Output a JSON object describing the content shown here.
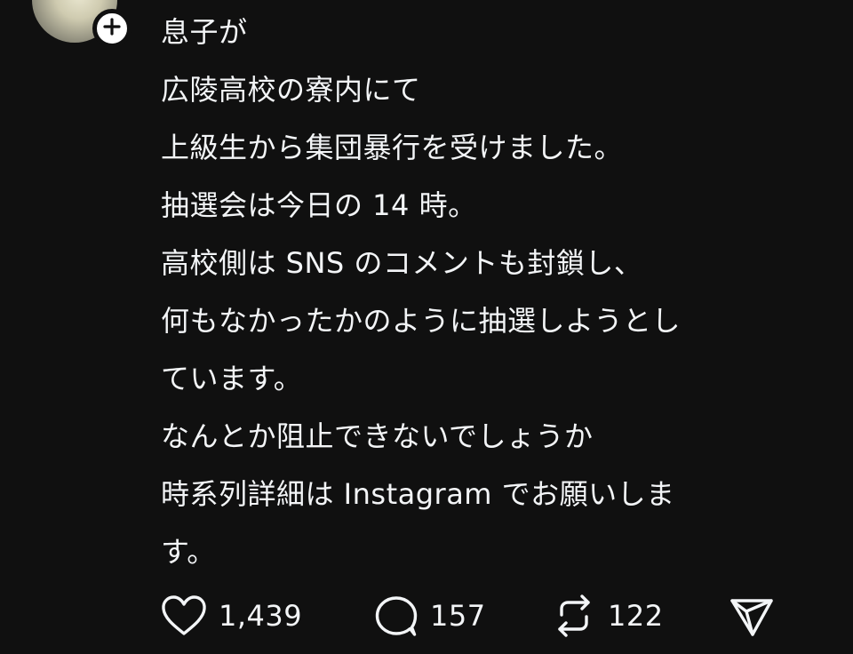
{
  "post": {
    "lines": [
      "息子が",
      "広陵高校の寮内にて",
      "上級生から集団暴行を受けました。",
      "抽選会は今日の 14 時。",
      "高校側は SNS のコメントも封鎖し、",
      "何もなかったかのように抽選しようとし",
      "ています。",
      "なんとか阻止できないでしょうか",
      "時系列詳細は Instagram でお願いしま",
      "す。"
    ]
  },
  "actions": {
    "like_count": "1,439",
    "reply_count": "157",
    "repost_count": "122",
    "like_icon": "heart-icon",
    "reply_icon": "speech-bubble-icon",
    "repost_icon": "repost-arrows-icon",
    "share_icon": "paper-plane-icon"
  },
  "avatar": {
    "badge_icon": "plus-icon"
  },
  "colors": {
    "background": "#101010",
    "text": "#f3f5f7",
    "icon": "#f3f5f7"
  }
}
